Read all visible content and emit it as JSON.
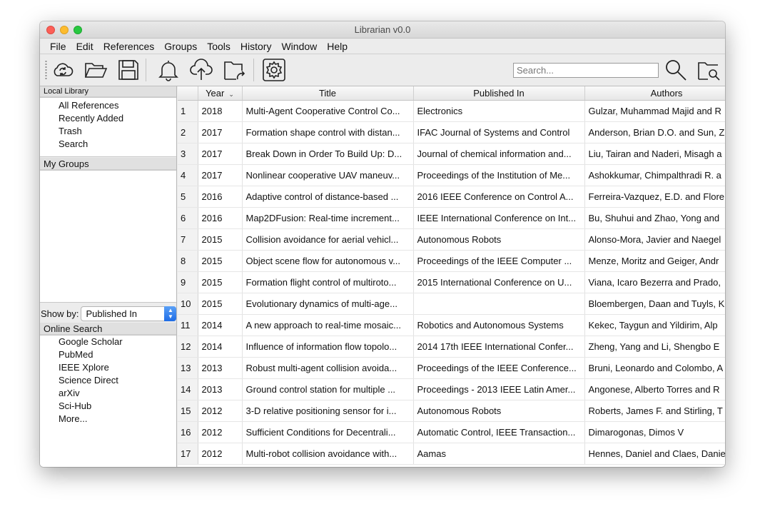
{
  "window": {
    "title": "Librarian v0.0"
  },
  "menu": [
    "File",
    "Edit",
    "References",
    "Groups",
    "Tools",
    "History",
    "Window",
    "Help"
  ],
  "toolbar": {
    "icons": [
      "sync-icon",
      "folder-open-icon",
      "save-icon",
      "bell-icon",
      "cloud-upload-icon",
      "folder-export-icon",
      "gear-icon",
      "search-icon",
      "folder-search-icon"
    ],
    "search_placeholder": "Search..."
  },
  "sidebar": {
    "local_library": {
      "header": "Local Library",
      "items": [
        "All References",
        "Recently Added",
        "Trash",
        "Search"
      ]
    },
    "my_groups": {
      "header": "My Groups"
    },
    "show_by": {
      "label": "Show by:",
      "value": "Published In"
    },
    "online_search": {
      "header": "Online Search",
      "items": [
        "Google Scholar",
        "PubMed",
        "IEEE Xplore",
        "Science Direct",
        "arXiv",
        "Sci-Hub",
        "More..."
      ]
    }
  },
  "table": {
    "columns": [
      "",
      "Year",
      "Title",
      "Published In",
      "Authors"
    ],
    "sort_indicator": "⌄",
    "rows": [
      [
        "1",
        "2018",
        "Multi-Agent Cooperative Control Co...",
        "Electronics",
        "Gulzar, Muhammad Majid and R"
      ],
      [
        "2",
        "2017",
        "Formation shape control with distan...",
        "IFAC Journal of Systems and Control",
        "Anderson, Brian D.O. and Sun, Z"
      ],
      [
        "3",
        "2017",
        "Break Down in Order To Build Up: D...",
        "Journal of chemical information and...",
        "Liu, Tairan and Naderi, Misagh a"
      ],
      [
        "4",
        "2017",
        "Nonlinear cooperative UAV maneuv...",
        "Proceedings of the Institution of Me...",
        "Ashokkumar, Chimpalthradi R. a"
      ],
      [
        "5",
        "2016",
        "Adaptive control of distance-based ...",
        "2016 IEEE Conference on Control A...",
        "Ferreira-Vazquez, E.D. and Flore"
      ],
      [
        "6",
        "2016",
        "Map2DFusion: Real-time increment...",
        "IEEE International Conference on Int...",
        "Bu, Shuhui and Zhao, Yong and"
      ],
      [
        "7",
        "2015",
        "Collision avoidance for aerial vehicl...",
        "Autonomous Robots",
        "Alonso-Mora, Javier and Naegel"
      ],
      [
        "8",
        "2015",
        "Object scene flow for autonomous v...",
        "Proceedings of the IEEE Computer ...",
        "Menze, Moritz and Geiger, Andr"
      ],
      [
        "9",
        "2015",
        "Formation flight control of multiroto...",
        "2015 International Conference on U...",
        "Viana, Icaro Bezerra and Prado,"
      ],
      [
        "10",
        "2015",
        "Evolutionary dynamics of multi-age...",
        "",
        "Bloembergen, Daan and Tuyls, K"
      ],
      [
        "11",
        "2014",
        "A new approach to real-time mosaic...",
        "Robotics and Autonomous Systems",
        "Kekec, Taygun and Yildirim, Alp"
      ],
      [
        "12",
        "2014",
        "Influence of information flow topolo...",
        "2014 17th IEEE International Confer...",
        "Zheng, Yang and Li, Shengbo E"
      ],
      [
        "13",
        "2013",
        "Robust multi-agent collision avoida...",
        "Proceedings of the IEEE Conference...",
        "Bruni, Leonardo and Colombo, A"
      ],
      [
        "14",
        "2013",
        "Ground control station for multiple ...",
        "Proceedings - 2013 IEEE Latin Amer...",
        "Angonese, Alberto Torres and R"
      ],
      [
        "15",
        "2012",
        "3-D relative positioning sensor for i...",
        "Autonomous Robots",
        "Roberts, James F. and Stirling, T"
      ],
      [
        "16",
        "2012",
        "Sufficient Conditions for Decentrali...",
        "Automatic Control, IEEE Transaction...",
        "Dimarogonas, Dimos V"
      ],
      [
        "17",
        "2012",
        "Multi-robot collision avoidance with...",
        "Aamas",
        "Hennes, Daniel and Claes, Danie"
      ]
    ]
  }
}
